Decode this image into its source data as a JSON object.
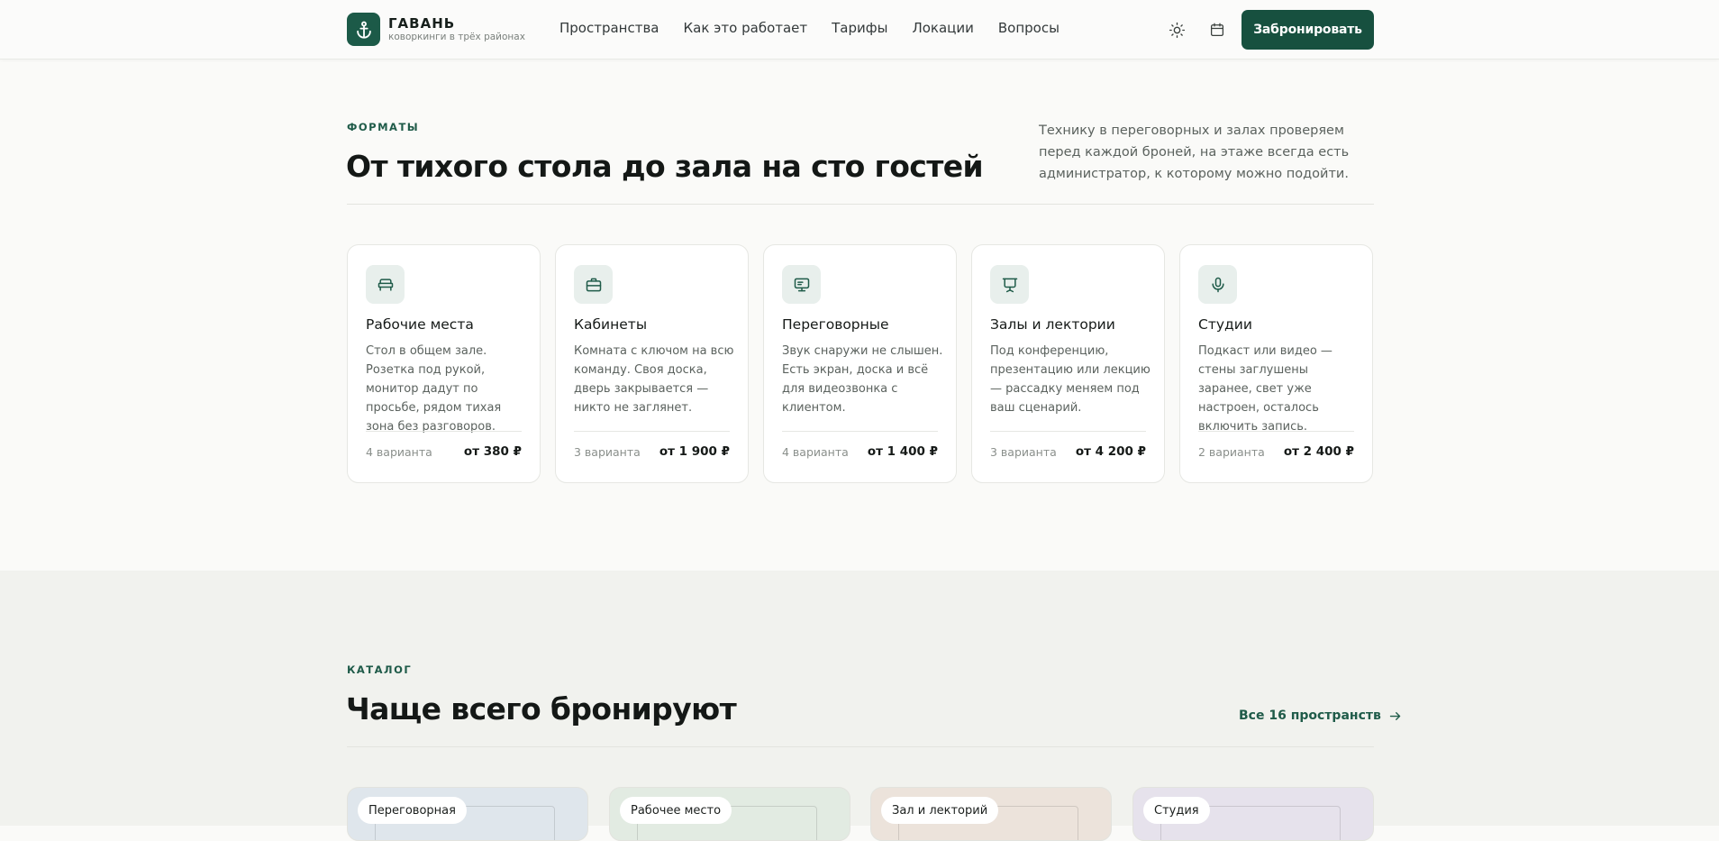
{
  "brand": {
    "title": "ГАВАНЬ",
    "subtitle": "коворкинги в трёх районах",
    "accent": "#1c5a48"
  },
  "nav": [
    "Пространства",
    "Как это работает",
    "Тарифы",
    "Локации",
    "Вопросы"
  ],
  "header_icons": [
    "sun-icon",
    "calendar-icon"
  ],
  "book_button": "Забронировать",
  "formats": {
    "eyebrow": "ФОРМАТЫ",
    "title": "От тихого стола до зала на сто гостей",
    "intro": "Технику в переговорных и залах проверяем перед каждой броней, на этаже всегда есть администратор, к которому можно подойти.",
    "cards": [
      {
        "icon": "desk-icon",
        "title": "Рабочие места",
        "desc": "Стол в общем зале. Розетка под рукой, монитор дадут по просьбе, рядом тихая зона без разговоров.",
        "count": "4 варианта",
        "price": "от 380 ₽"
      },
      {
        "icon": "briefcase-icon",
        "title": "Кабинеты",
        "desc": "Комната с ключом на всю команду. Своя доска, дверь закрывается — никто не заглянет.",
        "count": "3 варианта",
        "price": "от 1 900 ₽"
      },
      {
        "icon": "monitor-icon",
        "title": "Переговорные",
        "desc": "Звук снаружи не слышен. Есть экран, доска и всё для видеозвонка с клиентом.",
        "count": "4 варианта",
        "price": "от 1 400 ₽"
      },
      {
        "icon": "presentation-icon",
        "title": "Залы и лектории",
        "desc": "Под конференцию, презентацию или лекцию — рассадку меняем под ваш сценарий.",
        "count": "3 варианта",
        "price": "от 4 200 ₽"
      },
      {
        "icon": "microphone-icon",
        "title": "Студии",
        "desc": "Подкаст или видео — стены заглушены заранее, свет уже настроен, осталось включить запись.",
        "count": "2 варианта",
        "price": "от 2 400 ₽"
      }
    ]
  },
  "catalog": {
    "eyebrow": "КАТАЛОГ",
    "title": "Чаще всего бронируют",
    "all_link": "Все 16 пространств",
    "tiles": [
      {
        "badge": "Переговорная",
        "color": "#dfe6ec"
      },
      {
        "badge": "Рабочее место",
        "color": "#e2ebe2"
      },
      {
        "badge": "Зал и лекторий",
        "color": "#ece3db"
      },
      {
        "badge": "Студия",
        "color": "#e6e2ec"
      }
    ]
  }
}
